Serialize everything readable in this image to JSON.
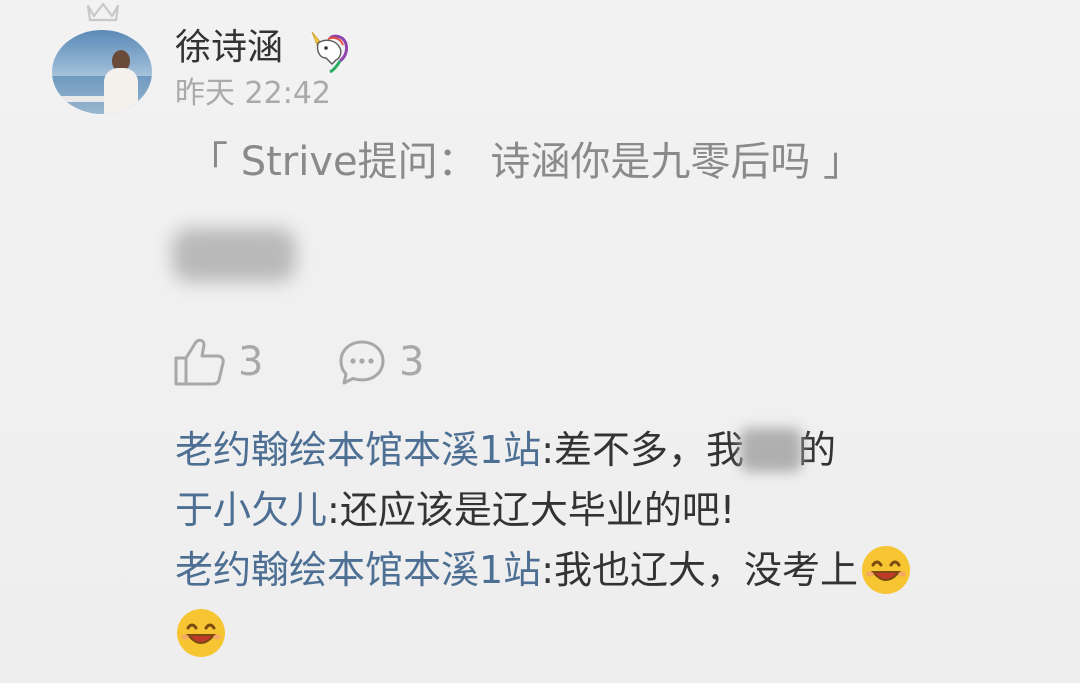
{
  "post": {
    "username": "徐诗涵",
    "username_badge_icon": "unicorn-icon",
    "top_badge_icon": "crown-icon",
    "timestamp": "昨天 22:42",
    "quote": "「 Strive提问：  诗涵你是九零后吗 」",
    "answer_blurred": true
  },
  "actions": {
    "like_icon": "thumbs-up-icon",
    "like_count": "3",
    "comment_icon": "speech-bubble-icon",
    "comment_count": "3"
  },
  "comments": [
    {
      "author": "老约翰绘本馆本溪1站",
      "separator": ": ",
      "text_before_blur": "差不多，我",
      "blurred": true,
      "text_after_blur": "的"
    },
    {
      "author": "于小欠儿",
      "separator": ": ",
      "text": "还应该是辽大毕业的吧!"
    },
    {
      "author": "老约翰绘本馆本溪1站",
      "separator": ": ",
      "text": "我也辽大，没考上",
      "emoji_icon": "grinning-face-icon",
      "extra_emoji_count": 1
    }
  ],
  "colors": {
    "background": "#f0f0f0",
    "username": "#333333",
    "timestamp": "#aaaaaa",
    "quote": "#8a8a8a",
    "author_link": "#4d6f93",
    "comment_text": "#333333",
    "action_gray": "#a8a8a8",
    "emoji_yellow": "#f7c531"
  }
}
